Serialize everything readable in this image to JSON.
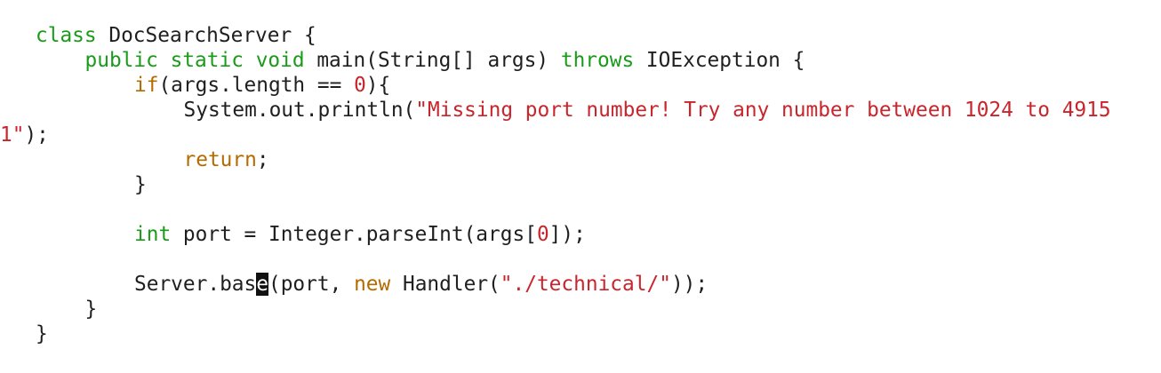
{
  "code": {
    "line1": {
      "kw_class": "class",
      "rest": " DocSearchServer {"
    },
    "line2": {
      "kw_public": "public",
      "kw_static": "static",
      "kw_void": "void",
      "main_sig": "main(String[] args)",
      "kw_throws": "throws",
      "rest": " IOException {"
    },
    "line3": {
      "kw_if": "if",
      "cond_start": "(args.length == ",
      "zero": "0",
      "cond_end": "){"
    },
    "line4": {
      "call": "System.out.println(",
      "string_part1": "\"Missing port number! Try any number between 1024 to 4915"
    },
    "line5": {
      "string_part2": "1\"",
      "end": ");"
    },
    "line6": {
      "kw_return": "return",
      "end": ";"
    },
    "line7": {
      "brace": "}"
    },
    "line8": {
      "kw_int": "int",
      "mid": " port = Integer.parseInt(args[",
      "zero": "0",
      "end": "]);"
    },
    "line9": {
      "before_cursor": "Server.bas",
      "cursor_char": "e",
      "after_cursor": "(port, ",
      "kw_new": "new",
      "handler": " Handler(",
      "path_string": "\"./technical/\"",
      "end": "));"
    },
    "line10": {
      "brace": "}"
    },
    "line11": {
      "brace": "}"
    }
  }
}
